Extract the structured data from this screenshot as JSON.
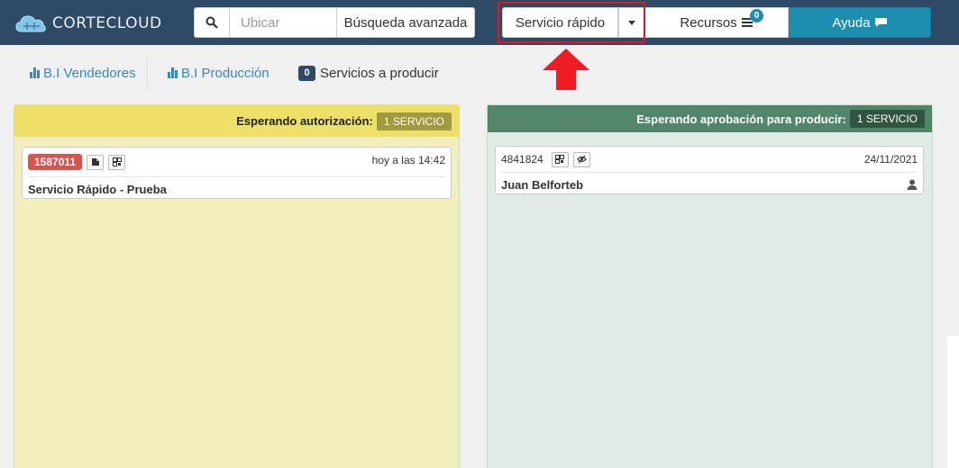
{
  "brand": {
    "name": "CORTECLOUD"
  },
  "navbar": {
    "search_placeholder": "Ubicar",
    "advanced_search_label": "Búsqueda avanzada",
    "quick_service_label": "Servicio rápido",
    "resources_label": "Recursos",
    "resources_count": "0",
    "help_label": "Ayuda"
  },
  "tabs": {
    "bi_sellers": "B.I Vendedores",
    "bi_production": "B.I Producción",
    "services_count": "0",
    "services_label": "Servicios a producir"
  },
  "columns": [
    {
      "title": "Esperando autorización:",
      "badge": "1 SERVICIO",
      "color": "#ede069",
      "cards": [
        {
          "id": "1587011",
          "time": "hoy a las 14:42",
          "title": "Servicio Rápido - Prueba"
        }
      ]
    },
    {
      "title": "Esperando aprobación para producir:",
      "badge": "1 SERVICIO",
      "color": "#52866a",
      "cards": [
        {
          "id": "4841824",
          "time": "24/11/2021",
          "title": "Juan Belforteb"
        }
      ]
    }
  ],
  "colors": {
    "navbar": "#2f4a66",
    "accent": "#1d8eb0",
    "highlight": "#e0171f",
    "order_badge": "#d9534f"
  }
}
